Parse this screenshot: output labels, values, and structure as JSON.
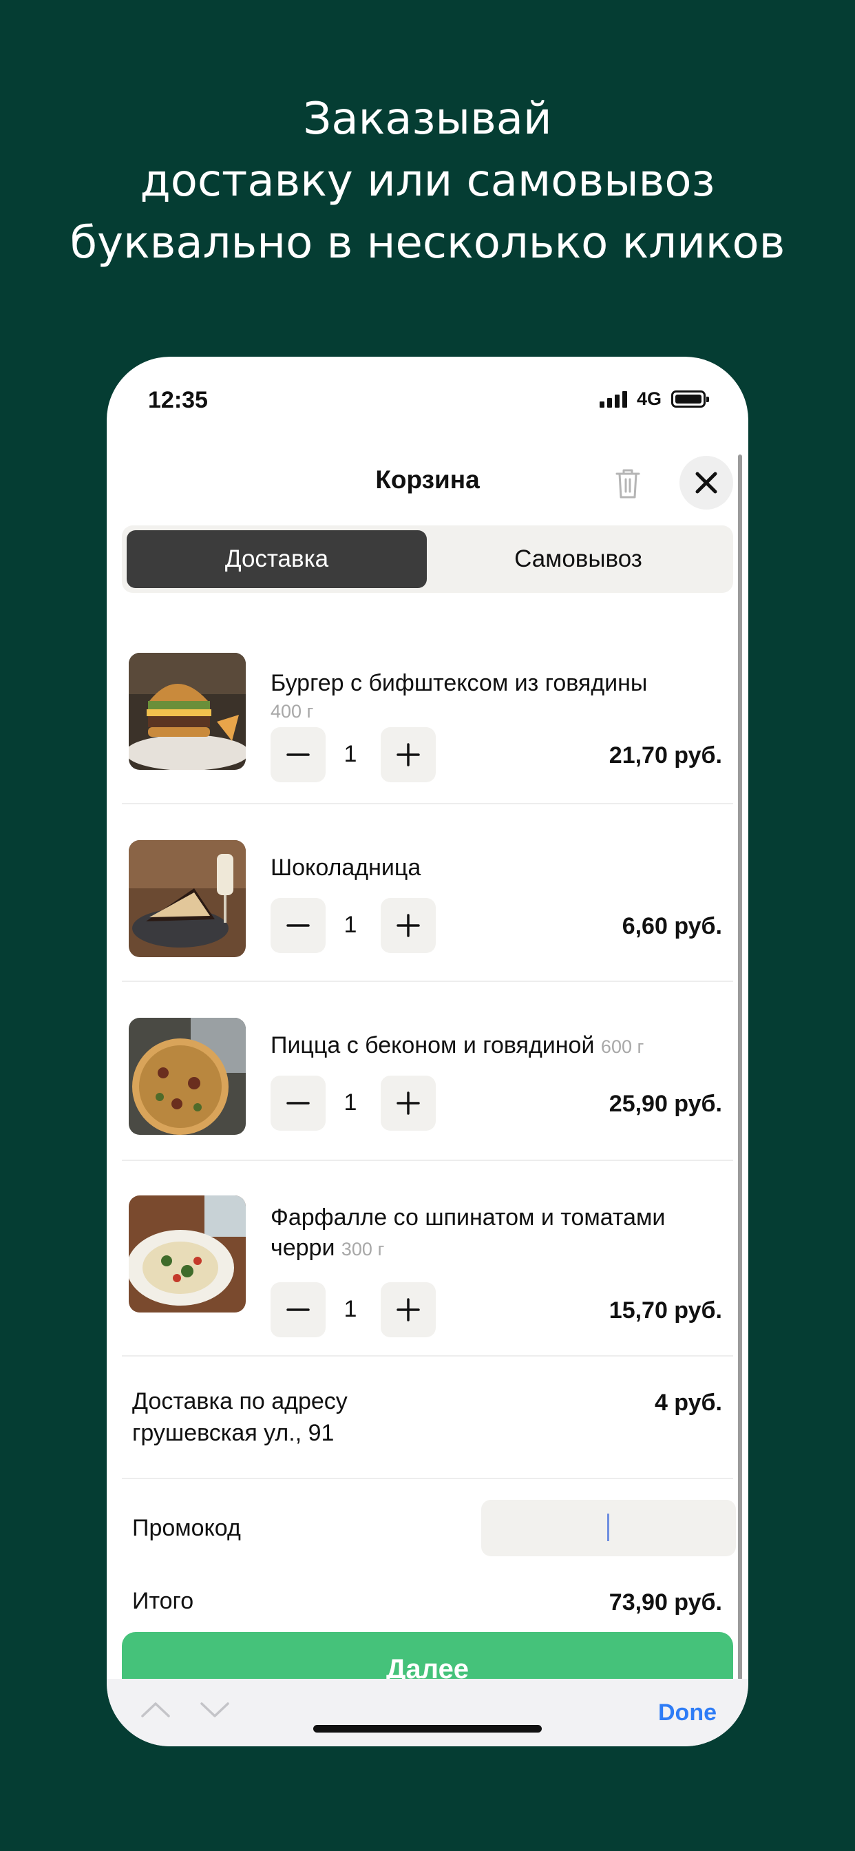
{
  "headline": {
    "line1": "Заказывай",
    "line2": "доставку или самовывоз",
    "line3": "буквально в несколько кликов"
  },
  "status_bar": {
    "time": "12:35",
    "network": "4G"
  },
  "cart": {
    "title": "Корзина",
    "tabs": {
      "delivery": "Доставка",
      "pickup": "Самовывоз",
      "active": "delivery"
    },
    "items": [
      {
        "name": "Бургер с бифштексом из говядины",
        "weight": "400 г",
        "qty": "1",
        "price": "21,70 руб."
      },
      {
        "name": "Шоколадница",
        "weight": "",
        "qty": "1",
        "price": "6,60 руб."
      },
      {
        "name": "Пицца с беконом и говядиной",
        "weight": "600 г",
        "qty": "1",
        "price": "25,90 руб."
      },
      {
        "name": "Фарфалле со шпинатом и томатами черри",
        "weight": "300 г",
        "qty": "1",
        "price": "15,70 руб."
      }
    ],
    "delivery": {
      "label_line1": "Доставка по адресу",
      "label_line2": "грушевская ул., 91",
      "price": "4 руб."
    },
    "promo": {
      "label": "Промокод",
      "value": ""
    },
    "total": {
      "label": "Итого",
      "value": "73,90 руб."
    },
    "next_button": "Далее"
  },
  "keyboard_bar": {
    "done": "Done"
  },
  "colors": {
    "background": "#053d33",
    "accent_green": "#45c27a",
    "done_blue": "#2e7cf6",
    "segment_active": "#3c3c3c"
  },
  "icons": [
    "trash-icon",
    "close-icon",
    "minus-icon",
    "plus-icon",
    "chevron-up-icon",
    "chevron-down-icon",
    "signal-icon",
    "battery-icon"
  ]
}
